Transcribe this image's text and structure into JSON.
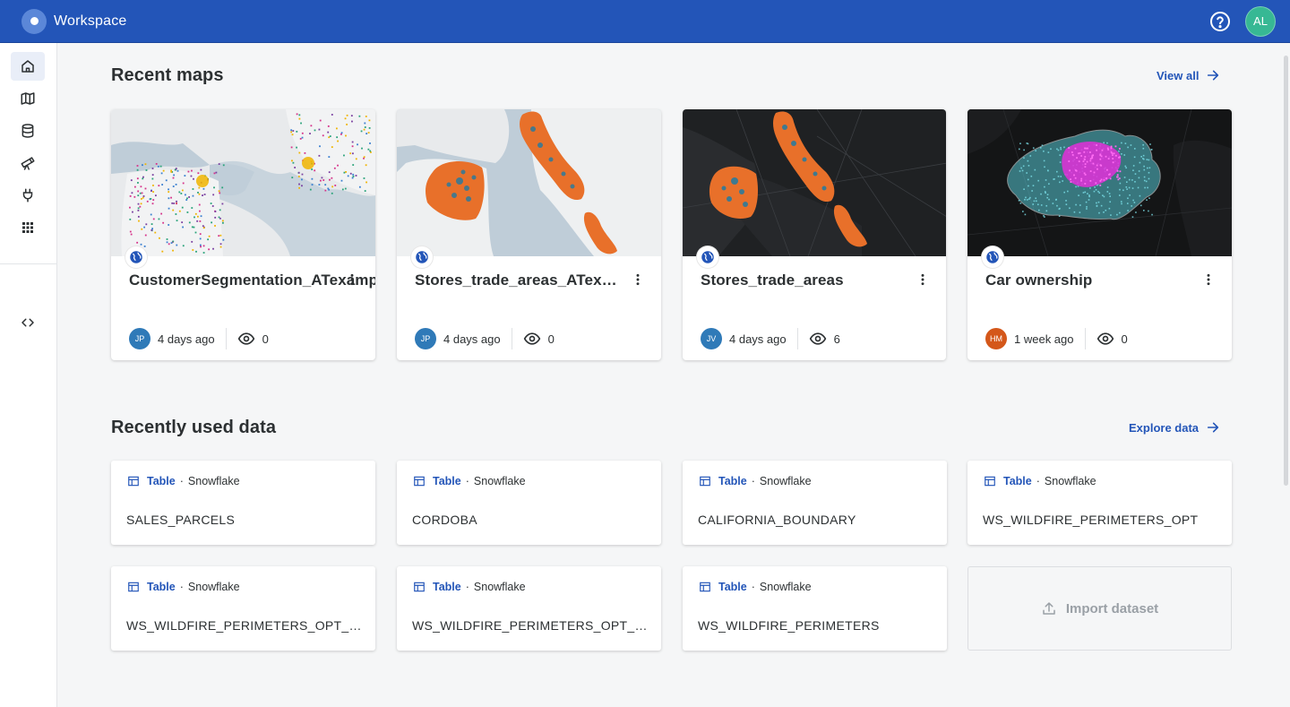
{
  "app": {
    "title": "Workspace",
    "user_initials": "AL"
  },
  "colors": {
    "primary": "#2355b8",
    "accent_orange": "#e8702a",
    "accent_teal": "#2d7a9b",
    "user_avatar": "#37b894"
  },
  "sidebar": {
    "items": [
      {
        "icon": "home-icon",
        "active": true
      },
      {
        "icon": "map-icon"
      },
      {
        "icon": "database-icon"
      },
      {
        "icon": "telescope-icon"
      },
      {
        "icon": "plug-icon"
      },
      {
        "icon": "apps-grid-icon"
      },
      {
        "icon": "code-icon"
      }
    ]
  },
  "recent_maps": {
    "title": "Recent maps",
    "link": "View all",
    "cards": [
      {
        "name": "CustomerSegmentation_ATexample",
        "author": "JP",
        "author_color": "#2f7ab8",
        "time": "4 days ago",
        "views": "0",
        "basemap": "light"
      },
      {
        "name": "Stores_trade_areas_ATexa...",
        "author": "JP",
        "author_color": "#2f7ab8",
        "time": "4 days ago",
        "views": "0",
        "basemap": "light"
      },
      {
        "name": "Stores_trade_areas",
        "author": "JV",
        "author_color": "#2f7ab8",
        "time": "4 days ago",
        "views": "6",
        "basemap": "dark"
      },
      {
        "name": "Car ownership",
        "author": "HM",
        "author_color": "#d4571a",
        "time": "1 week ago",
        "views": "0",
        "basemap": "dark"
      }
    ]
  },
  "recent_data": {
    "title": "Recently used data",
    "link": "Explore data",
    "items": [
      {
        "type": "Table",
        "source": "Snowflake",
        "name": "SALES_PARCELS"
      },
      {
        "type": "Table",
        "source": "Snowflake",
        "name": "CORDOBA"
      },
      {
        "type": "Table",
        "source": "Snowflake",
        "name": "CALIFORNIA_BOUNDARY"
      },
      {
        "type": "Table",
        "source": "Snowflake",
        "name": "WS_WILDFIRE_PERIMETERS_OPT"
      },
      {
        "type": "Table",
        "source": "Snowflake",
        "name": "WS_WILDFIRE_PERIMETERS_OPT_EN..."
      },
      {
        "type": "Table",
        "source": "Snowflake",
        "name": "WS_WILDFIRE_PERIMETERS_OPT_EN..."
      },
      {
        "type": "Table",
        "source": "Snowflake",
        "name": "WS_WILDFIRE_PERIMETERS"
      }
    ],
    "import_label": "Import dataset"
  }
}
